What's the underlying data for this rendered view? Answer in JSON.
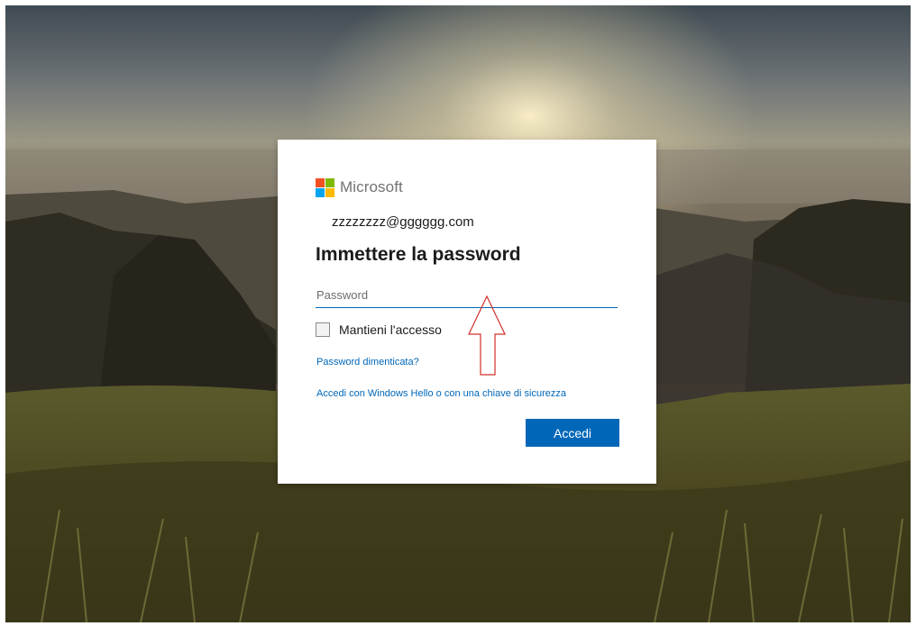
{
  "brand": {
    "name": "Microsoft",
    "colors": {
      "red": "#f25022",
      "green": "#7fba00",
      "blue": "#00a4ef",
      "yellow": "#ffb900"
    }
  },
  "signin": {
    "identity": "zzzzzzzz@gggggg.com",
    "title": "Immettere la password",
    "password_placeholder": "Password",
    "keep_signed_in_label": "Mantieni l'accesso",
    "forgot_password_link": "Password dimenticata?",
    "windows_hello_link": "Accedi con Windows Hello o con una chiave di sicurezza",
    "submit_label": "Accedi"
  },
  "annotation": {
    "icon": "up-arrow-outline-icon",
    "color": "#d0302a"
  },
  "background": {
    "description_icon": "landscape-background-image"
  }
}
